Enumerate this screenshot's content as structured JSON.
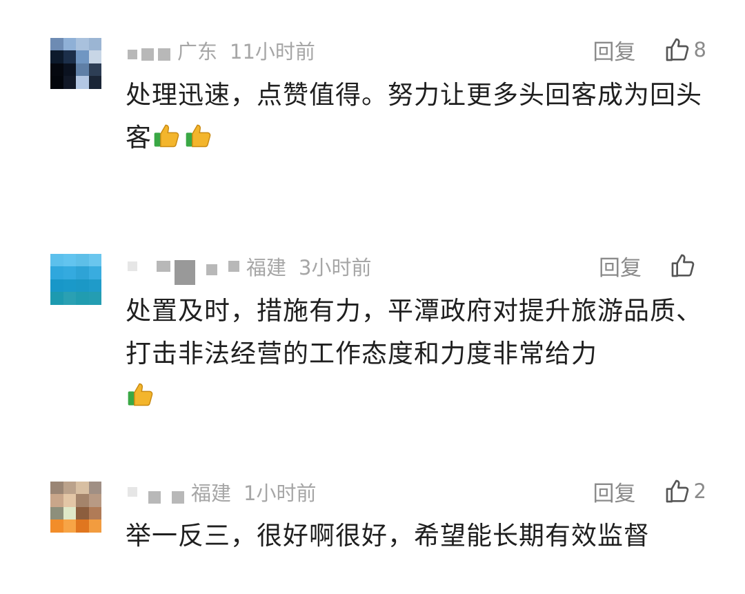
{
  "comments": [
    {
      "location": "广东",
      "time": "11小时前",
      "reply_label": "回复",
      "like_count": "8",
      "text": "处理迅速，点赞值得。努力让更多头回客成为回头客",
      "emojis": [
        "thumbs-up",
        "thumbs-up"
      ]
    },
    {
      "location": "福建",
      "time": "3小时前",
      "reply_label": "回复",
      "like_count": "",
      "text": "处置及时，措施有力，平潭政府对提升旅游品质、打击非法经营的工作态度和力度非常给力",
      "emojis": [
        "thumbs-up"
      ]
    },
    {
      "location": "福建",
      "time": "1小时前",
      "reply_label": "回复",
      "like_count": "2",
      "text": "举一反三，很好啊很好，希望能长期有效监督",
      "emojis": []
    }
  ],
  "icons": {
    "like": "thumbs-up-outline-icon",
    "emoji": "thumbs-up-emoji-icon"
  },
  "colors": {
    "meta_text": "#a6a6a6",
    "action_text": "#8a8a8a",
    "body_text": "#1f1f1f"
  }
}
